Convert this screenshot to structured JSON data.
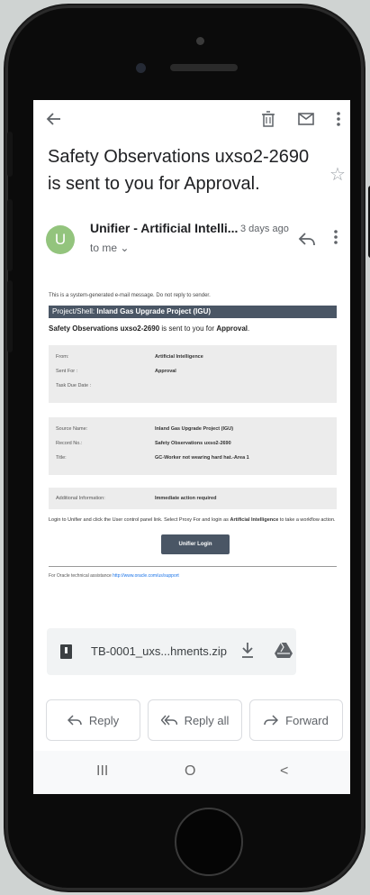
{
  "email": {
    "subject": "Safety Observations uxso2-2690 is sent to you for Approval.",
    "avatar_letter": "U",
    "sender": "Unifier - Artificial Intelli...",
    "date": "3 days ago",
    "to": "to me ⌄"
  },
  "body": {
    "system_message": "This is a system-generated e-mail message. Do not reply to sender.",
    "project_label": "Project/Shell:",
    "project_name": "Inland Gas Upgrade Project (IGU)",
    "headline_bold": "Safety Observations uxso2-2690",
    "headline_mid": " is sent to you for ",
    "headline_end": "Approval",
    "headline_dot": ".",
    "box1": [
      {
        "label": "From:",
        "value": "Artificial Intelligence"
      },
      {
        "label": "Sent For :",
        "value": "Approval"
      },
      {
        "label": "Task Due Date :",
        "value": ""
      }
    ],
    "box2": [
      {
        "label": "Source Name:",
        "value": "Inland Gas Upgrade Project (IGU)"
      },
      {
        "label": "Record No.:",
        "value": "Safety Observations uxso2-2690"
      },
      {
        "label": "Title:",
        "value": "GC-Worker not wearing hard hat.-Area 1"
      }
    ],
    "box3": {
      "label": "Additional Information:",
      "value": "Immediate action required"
    },
    "login_info_a": "Login to Unifier and click the User control panel link. Select Proxy For and login as ",
    "login_info_b": "Artificial Intelligence",
    "login_info_c": " to take a workflow action.",
    "login_button": "Unifier Login",
    "assist_text": "For Oracle technical assistance ",
    "assist_link": "http://www.oracle.com/us/support"
  },
  "attachment": {
    "filename": "TB-0001_uxs...hments.zip"
  },
  "actions": {
    "reply": "Reply",
    "reply_all": "Reply all",
    "forward": "Forward"
  },
  "nav": {
    "recents": "III",
    "home": "O",
    "back": "<"
  },
  "colors": {
    "avatar": "#93c47d",
    "project_bar": "#4a5665",
    "link": "#1a73e8"
  }
}
